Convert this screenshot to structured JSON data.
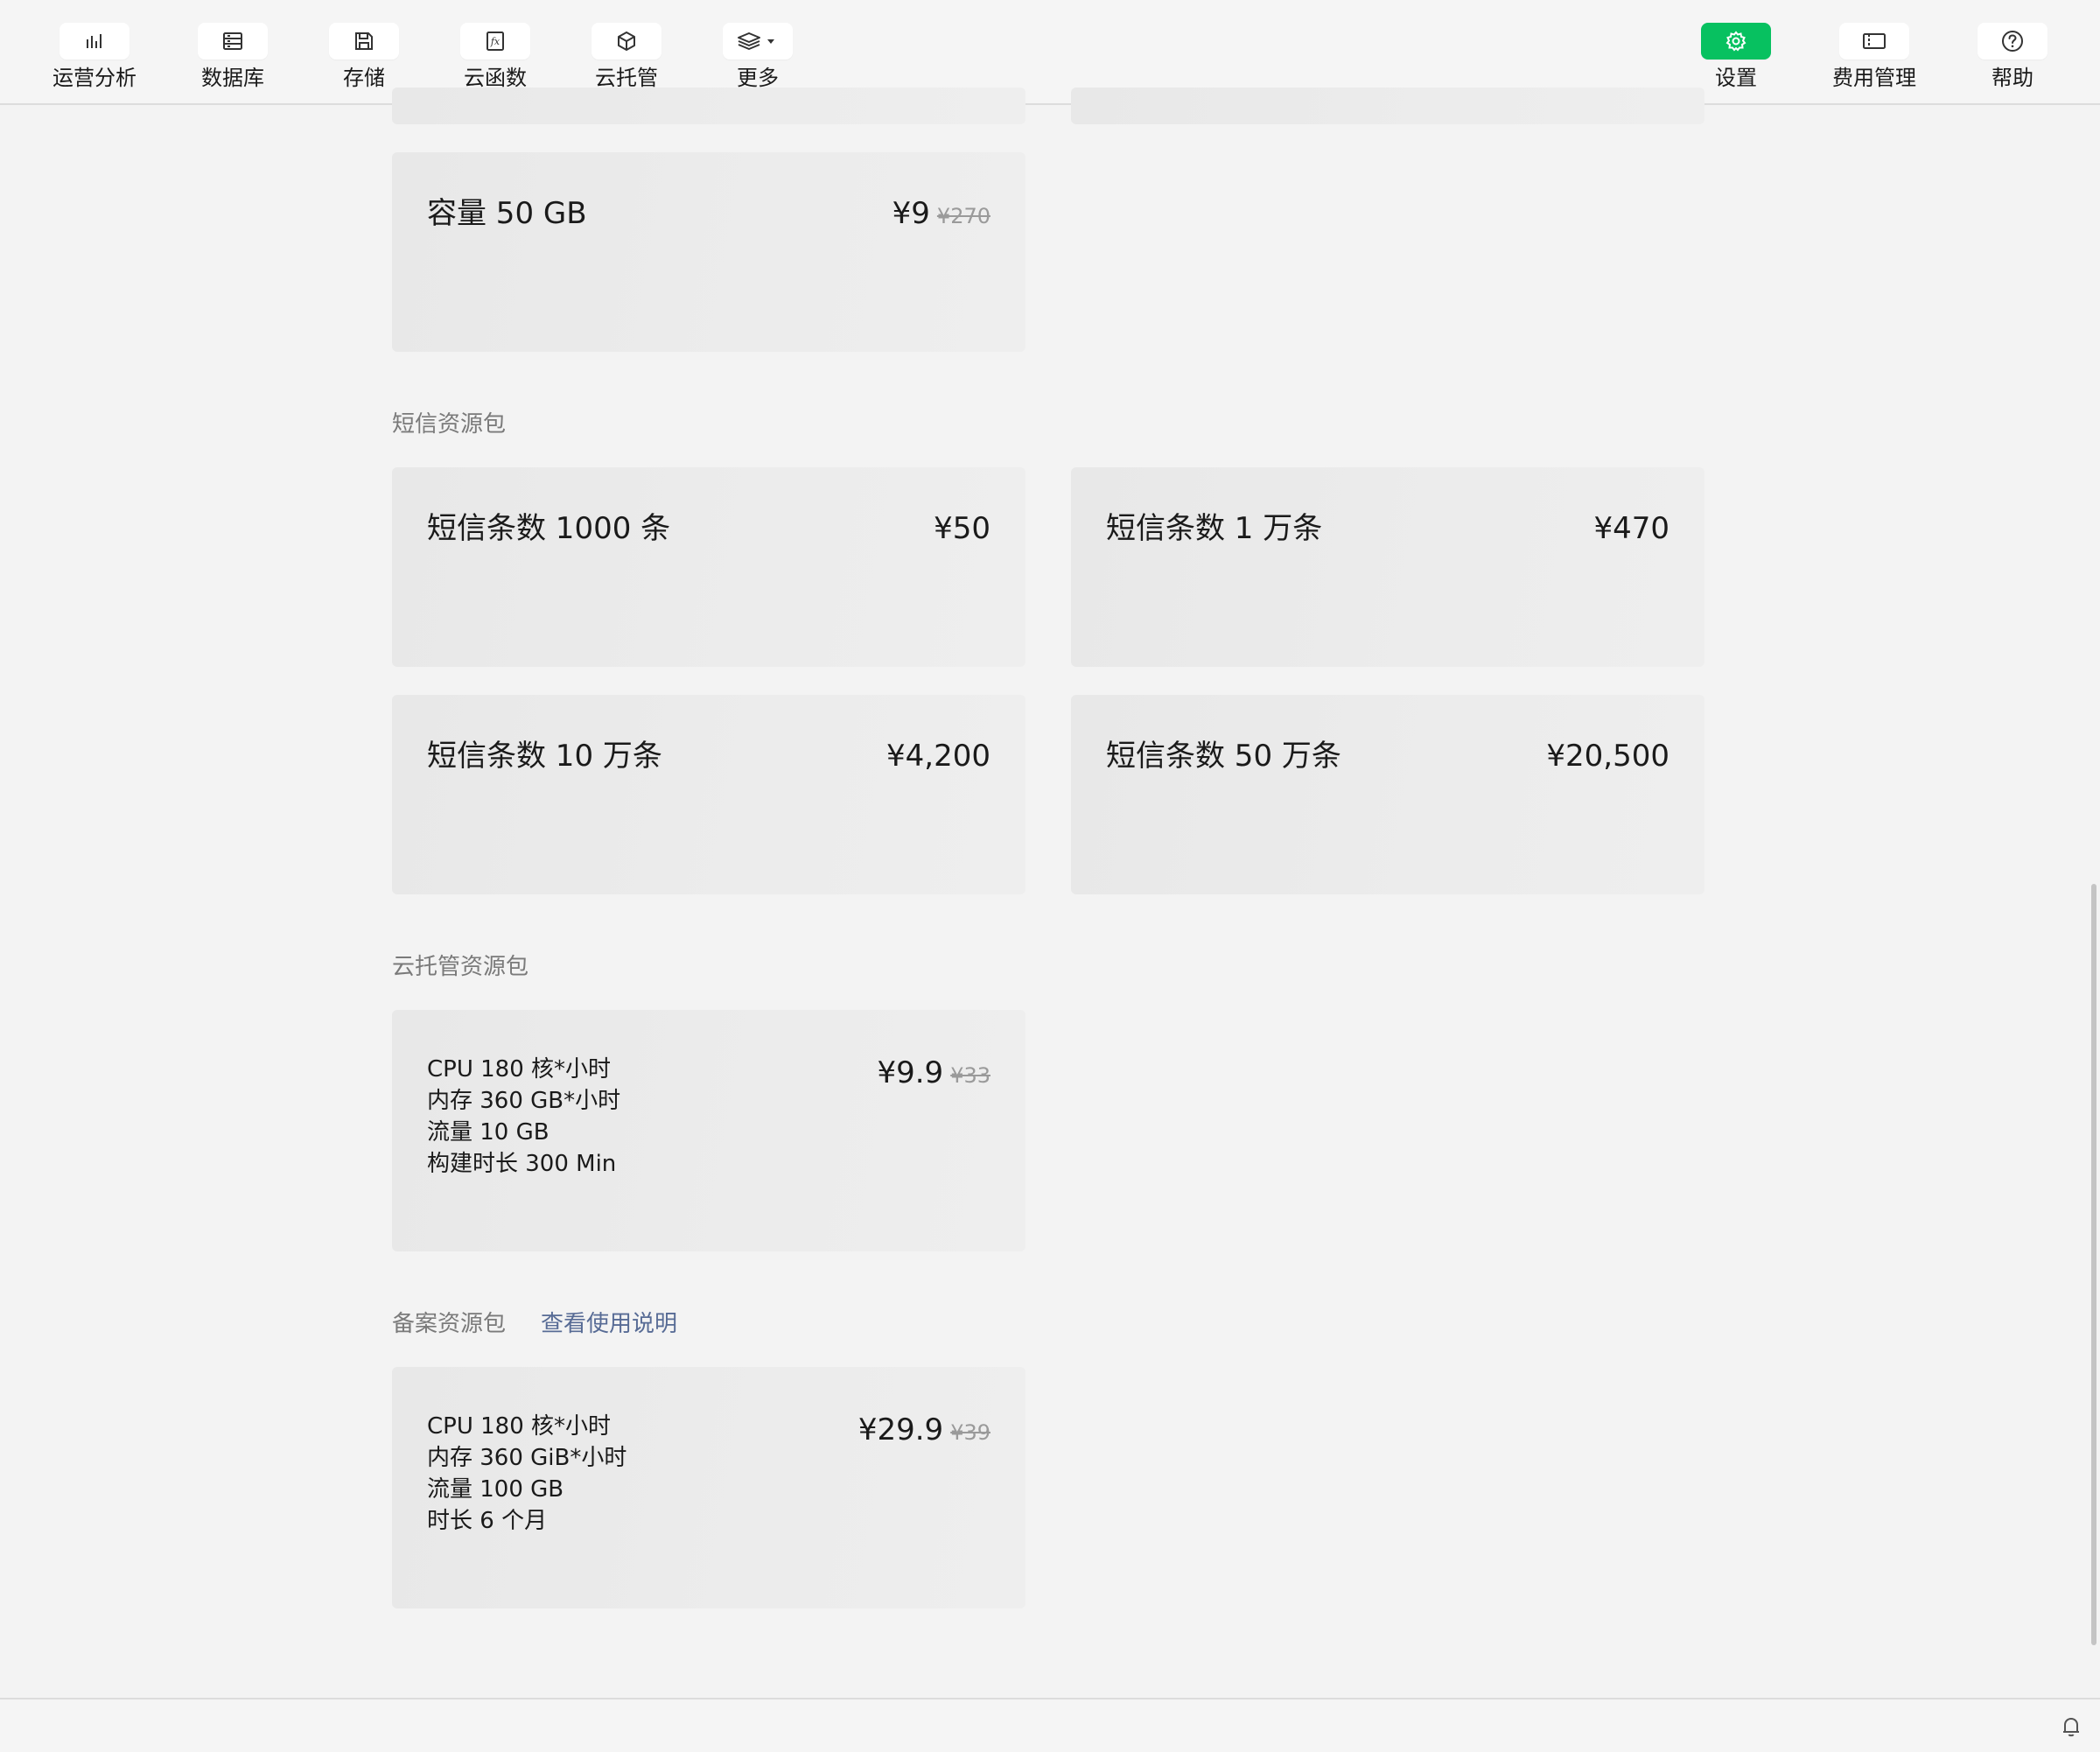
{
  "toolbar": {
    "left_items": [
      {
        "label": "运营分析",
        "icon": "bar-chart-icon"
      },
      {
        "label": "数据库",
        "icon": "database-icon"
      },
      {
        "label": "存储",
        "icon": "save-icon"
      },
      {
        "label": "云函数",
        "icon": "function-icon"
      },
      {
        "label": "云托管",
        "icon": "cube-icon"
      },
      {
        "label": "更多",
        "icon": "layers-icon"
      }
    ],
    "right_items": [
      {
        "label": "设置",
        "icon": "gear-icon",
        "active": true
      },
      {
        "label": "费用管理",
        "icon": "ticket-icon"
      },
      {
        "label": "帮助",
        "icon": "help-icon"
      }
    ]
  },
  "colors": {
    "accent": "#07c160",
    "link": "#576b95",
    "background": "#f3f3f3"
  },
  "storage_pack": {
    "card": {
      "title": "容量 50 GB",
      "price": "¥9",
      "original_price": "¥270"
    }
  },
  "sms_pack": {
    "section_title": "短信资源包",
    "cards": [
      {
        "title": "短信条数 1000 条",
        "price": "¥50"
      },
      {
        "title": "短信条数 1 万条",
        "price": "¥470"
      },
      {
        "title": "短信条数 10 万条",
        "price": "¥4,200"
      },
      {
        "title": "短信条数 50 万条",
        "price": "¥20,500"
      }
    ]
  },
  "cloudrun_pack": {
    "section_title": "云托管资源包",
    "card": {
      "lines": [
        "CPU 180 核*小时",
        "内存 360 GB*小时",
        "流量 10 GB",
        "构建时长 300 Min"
      ],
      "price": "¥9.9",
      "original_price": "¥33"
    }
  },
  "filing_pack": {
    "section_title": "备案资源包",
    "link": "查看使用说明",
    "card": {
      "lines": [
        "CPU 180 核*小时",
        "内存 360 GiB*小时",
        "流量 100 GB",
        "时长 6 个月"
      ],
      "price": "¥29.9",
      "original_price": "¥39"
    }
  },
  "statusbar": {
    "icon": "bell-icon"
  }
}
